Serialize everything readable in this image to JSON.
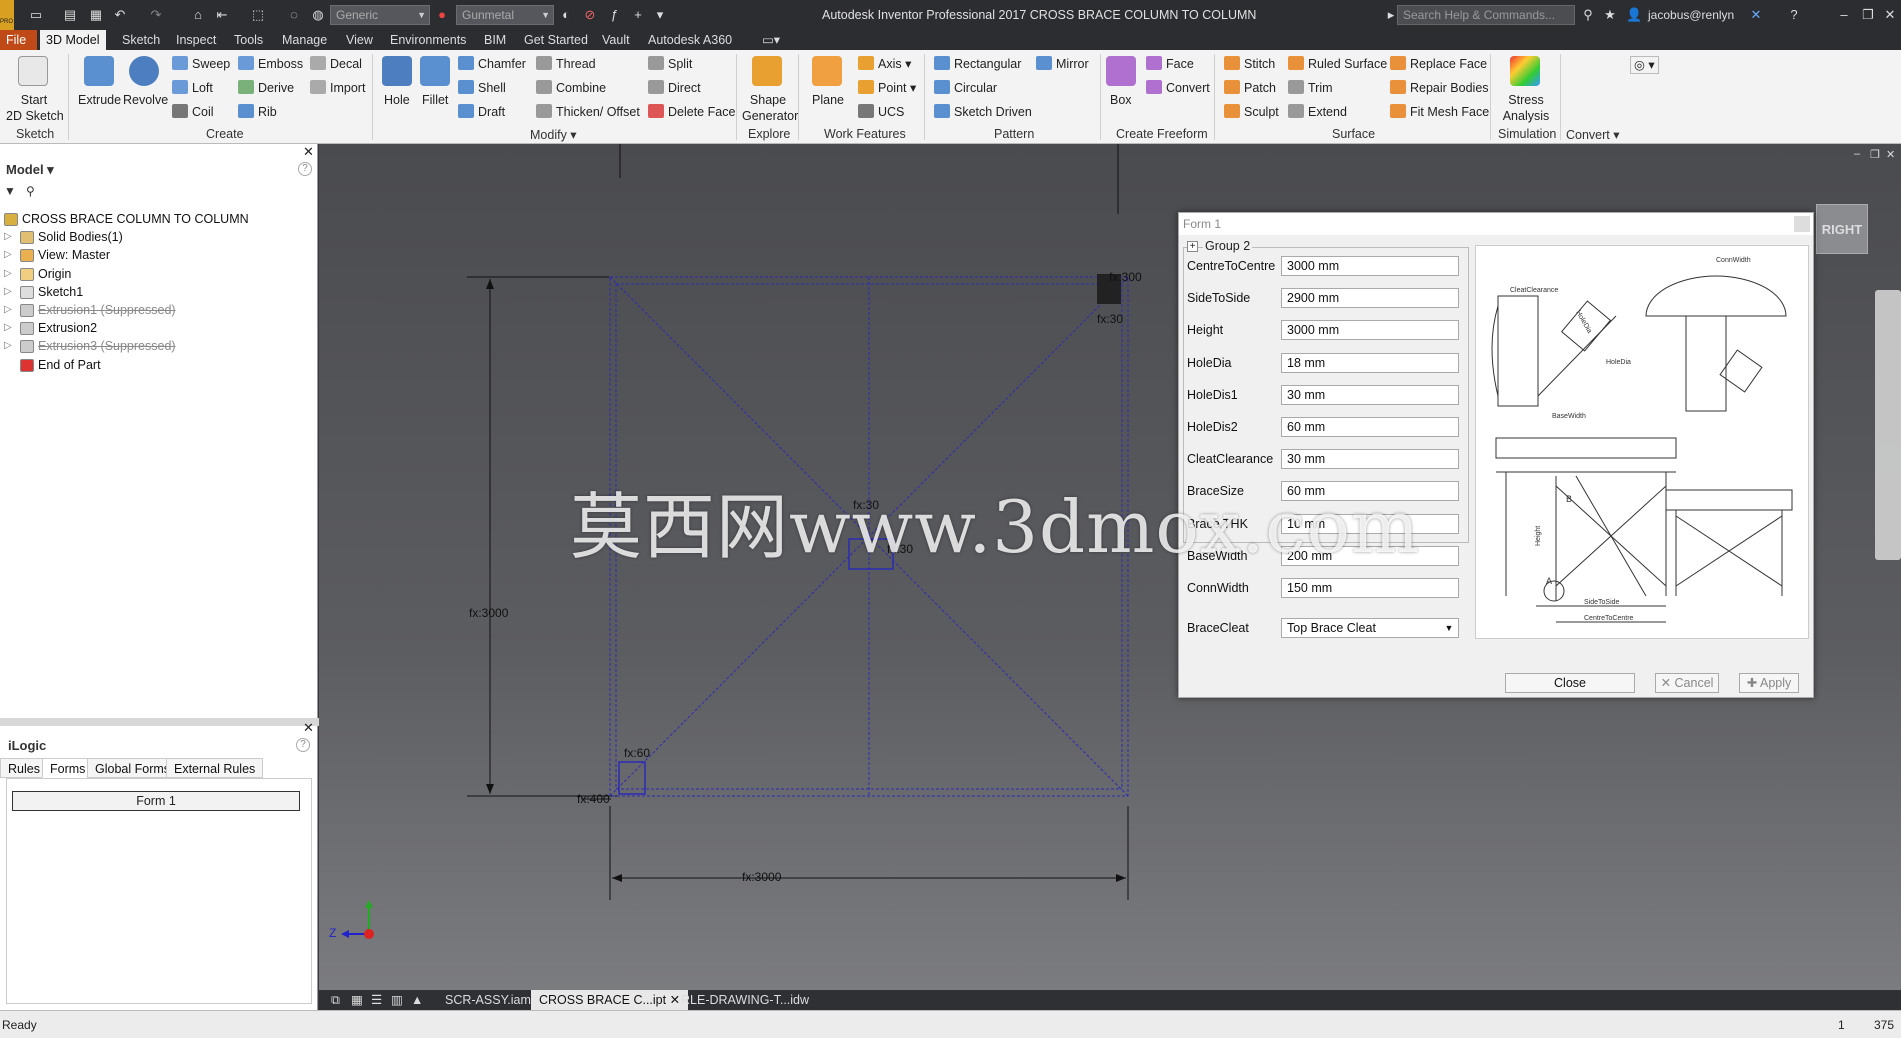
{
  "titlebar": {
    "app_title": "Autodesk Inventor Professional 2017   CROSS BRACE COLUMN TO COLUMN",
    "material_value": "Generic",
    "appearance_value": "Gunmetal",
    "search_placeholder": "Search Help & Commands...",
    "user": "jacobus@renlyn",
    "app_badge": "PRO"
  },
  "menu_tabs": [
    "File",
    "3D Model",
    "Sketch",
    "Inspect",
    "Tools",
    "Manage",
    "View",
    "Environments",
    "BIM",
    "Get Started",
    "Vault",
    "Autodesk A360"
  ],
  "ribbon": {
    "sketch": {
      "start_line1": "Start",
      "start_line2": "2D Sketch",
      "group": "Sketch"
    },
    "create": {
      "extrude": "Extrude",
      "revolve": "Revolve",
      "sweep": "Sweep",
      "loft": "Loft",
      "coil": "Coil",
      "emboss": "Emboss",
      "derive": "Derive",
      "rib": "Rib",
      "decal": "Decal",
      "import": "Import",
      "group": "Create"
    },
    "modify": {
      "hole": "Hole",
      "fillet": "Fillet",
      "chamfer": "Chamfer",
      "shell": "Shell",
      "draft": "Draft",
      "thread": "Thread",
      "combine": "Combine",
      "thicken": "Thicken/ Offset",
      "split": "Split",
      "direct": "Direct",
      "delete_face": "Delete Face",
      "group": "Modify"
    },
    "explore": {
      "shape_gen_line1": "Shape",
      "shape_gen_line2": "Generator",
      "group": "Explore"
    },
    "work": {
      "plane": "Plane",
      "axis": "Axis",
      "point": "Point",
      "ucs": "UCS",
      "group": "Work Features"
    },
    "pattern": {
      "rectangular": "Rectangular",
      "circular": "Circular",
      "sketch_driven": "Sketch Driven",
      "mirror": "Mirror",
      "group": "Pattern"
    },
    "freeform": {
      "box": "Box",
      "face": "Face",
      "convert": "Convert",
      "group": "Create Freeform"
    },
    "surface": {
      "stitch": "Stitch",
      "patch": "Patch",
      "sculpt": "Sculpt",
      "ruled": "Ruled Surface",
      "trim": "Trim",
      "extend": "Extend",
      "replace": "Replace Face",
      "repair": "Repair Bodies",
      "fit_mesh": "Fit Mesh Face",
      "group": "Surface"
    },
    "simulation": {
      "stress_line1": "Stress",
      "stress_line2": "Analysis",
      "group": "Simulation"
    },
    "convert": {
      "group": "Convert"
    }
  },
  "model_panel": {
    "title": "Model",
    "items": [
      {
        "label": "CROSS BRACE COLUMN TO COLUMN",
        "suppressed": false
      },
      {
        "label": "Solid Bodies(1)",
        "suppressed": false
      },
      {
        "label": "View: Master",
        "suppressed": false
      },
      {
        "label": "Origin",
        "suppressed": false
      },
      {
        "label": "Sketch1",
        "suppressed": false
      },
      {
        "label": "Extrusion1 (Suppressed)",
        "suppressed": true
      },
      {
        "label": "Extrusion2",
        "suppressed": false
      },
      {
        "label": "Extrusion3 (Suppressed)",
        "suppressed": true
      },
      {
        "label": "End of Part",
        "suppressed": false
      }
    ]
  },
  "ilogic_panel": {
    "title": "iLogic",
    "tabs": [
      "Rules",
      "Forms",
      "Global Forms",
      "External Rules"
    ],
    "form_button": "Form 1"
  },
  "viewport": {
    "dim_height": "fx:3000",
    "dim_width": "fx:3000",
    "dim_offset": "fx:400",
    "dim_top_right": "fx:300",
    "dim_top_right2": "fx:30",
    "dim_bottom_left": "fx:60",
    "dim_center": "fx:30",
    "dim_center2": "fx:30",
    "viewcube_label": "RIGHT",
    "axis_z": "Z",
    "watermark": "莫西网www.3dmox.com"
  },
  "form": {
    "title": "Form 1",
    "group": "Group 2",
    "fields": [
      {
        "label": "CentreToCentre",
        "value": "3000 mm"
      },
      {
        "label": "SideToSide",
        "value": "2900 mm"
      },
      {
        "label": "Height",
        "value": "3000 mm"
      },
      {
        "label": "HoleDia",
        "value": "18 mm"
      },
      {
        "label": "HoleDis1",
        "value": "30 mm"
      },
      {
        "label": "HoleDis2",
        "value": "60 mm"
      },
      {
        "label": "CleatClearance",
        "value": "30 mm"
      },
      {
        "label": "BraceSize",
        "value": "60 mm"
      },
      {
        "label": "Brace THK",
        "value": "10 mm"
      },
      {
        "label": "BaseWidth",
        "value": "200 mm"
      },
      {
        "label": "ConnWidth",
        "value": "150 mm"
      }
    ],
    "select_label": "BraceCleat",
    "select_value": "Top Brace Cleat",
    "image_labels": {
      "cleat": "CleatClearance",
      "hole": "HoleDia",
      "conn": "ConnWidth",
      "base": "BaseWidth",
      "b": "B",
      "a": "A",
      "height": "Height",
      "side": "SideToSide",
      "centre": "CentreToCentre",
      "holedia2": "HoleDia"
    },
    "close": "Close",
    "cancel": "Cancel",
    "apply": "Apply"
  },
  "doc_tabs": [
    "SCR-ASSY.iam",
    "CROSS BRACE C...ipt",
    "RLE-DRAWING-T...idw"
  ],
  "status": {
    "text": "Ready",
    "num1": "1",
    "num2": "375"
  },
  "colors": {
    "accent": "#c04a17",
    "sketch": "#2b2bb5",
    "dark": "#2c2d30"
  }
}
